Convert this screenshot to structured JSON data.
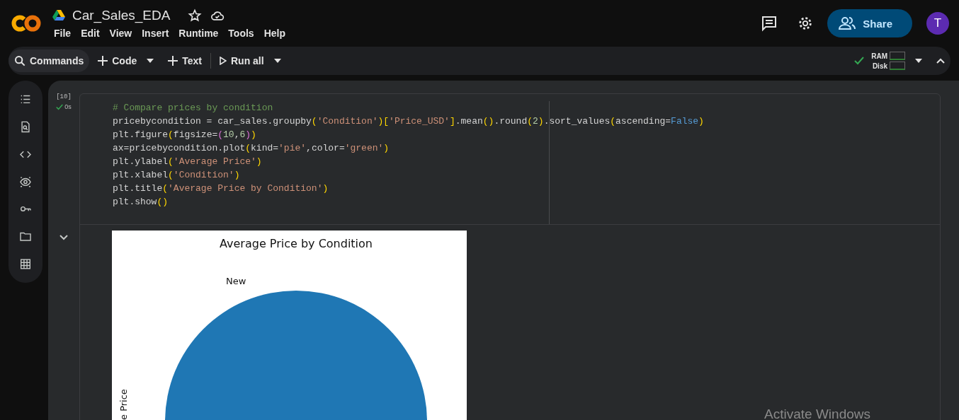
{
  "header": {
    "title": "Car_Sales_EDA",
    "starred": false,
    "menu": [
      "File",
      "Edit",
      "View",
      "Insert",
      "Runtime",
      "Tools",
      "Help"
    ],
    "share": "Share",
    "avatar": "T"
  },
  "toolbar": {
    "commands": "Commands",
    "code": "Code",
    "text": "Text",
    "run_all": "Run all",
    "ram": "RAM",
    "disk": "Disk"
  },
  "cell": {
    "exec_count": "[10]",
    "duration": "0s",
    "code": [
      [
        {
          "kind": "comment",
          "text": "# Compare prices by condition"
        }
      ],
      [
        {
          "kind": "plain",
          "text": "pricebycondition = car_sales.groupby"
        },
        {
          "kind": "bracket1",
          "text": "("
        },
        {
          "kind": "string",
          "text": "'Condition'"
        },
        {
          "kind": "bracket1",
          "text": ")["
        },
        {
          "kind": "string",
          "text": "'Price_USD'"
        },
        {
          "kind": "bracket1",
          "text": "]"
        },
        {
          "kind": "plain",
          "text": ".mean"
        },
        {
          "kind": "bracket1",
          "text": "()"
        },
        {
          "kind": "plain",
          "text": ".round"
        },
        {
          "kind": "bracket1",
          "text": "("
        },
        {
          "kind": "number",
          "text": "2"
        },
        {
          "kind": "bracket1",
          "text": ")"
        },
        {
          "kind": "plain",
          "text": ".sort_values"
        },
        {
          "kind": "bracket1",
          "text": "("
        },
        {
          "kind": "plain",
          "text": "ascending="
        },
        {
          "kind": "keyword",
          "text": "False"
        },
        {
          "kind": "bracket1",
          "text": ")"
        }
      ],
      [
        {
          "kind": "plain",
          "text": "plt.figure"
        },
        {
          "kind": "bracket1",
          "text": "("
        },
        {
          "kind": "plain",
          "text": "figsize="
        },
        {
          "kind": "bracket2",
          "text": "("
        },
        {
          "kind": "number",
          "text": "10"
        },
        {
          "kind": "plain",
          "text": ","
        },
        {
          "kind": "number",
          "text": "6"
        },
        {
          "kind": "bracket2",
          "text": ")"
        },
        {
          "kind": "bracket1",
          "text": ")"
        }
      ],
      [
        {
          "kind": "plain",
          "text": "ax=pricebycondition.plot"
        },
        {
          "kind": "bracket1",
          "text": "("
        },
        {
          "kind": "plain",
          "text": "kind="
        },
        {
          "kind": "string",
          "text": "'pie'"
        },
        {
          "kind": "plain",
          "text": ",color="
        },
        {
          "kind": "string",
          "text": "'green'"
        },
        {
          "kind": "bracket1",
          "text": ")"
        }
      ],
      [
        {
          "kind": "plain",
          "text": "plt.ylabel"
        },
        {
          "kind": "bracket1",
          "text": "("
        },
        {
          "kind": "string",
          "text": "'Average Price'"
        },
        {
          "kind": "bracket1",
          "text": ")"
        }
      ],
      [
        {
          "kind": "plain",
          "text": "plt.xlabel"
        },
        {
          "kind": "bracket1",
          "text": "("
        },
        {
          "kind": "string",
          "text": "'Condition'"
        },
        {
          "kind": "bracket1",
          "text": ")"
        }
      ],
      [
        {
          "kind": "plain",
          "text": "plt.title"
        },
        {
          "kind": "bracket1",
          "text": "("
        },
        {
          "kind": "string",
          "text": "'Average Price by Condition'"
        },
        {
          "kind": "bracket1",
          "text": ")"
        }
      ],
      [
        {
          "kind": "plain",
          "text": "plt.show"
        },
        {
          "kind": "bracket1",
          "text": "()"
        }
      ]
    ],
    "output": {
      "title": "Average Price by Condition",
      "slice_label": "New",
      "ylabel": "e Price"
    }
  },
  "watermark": "Activate Windows"
}
